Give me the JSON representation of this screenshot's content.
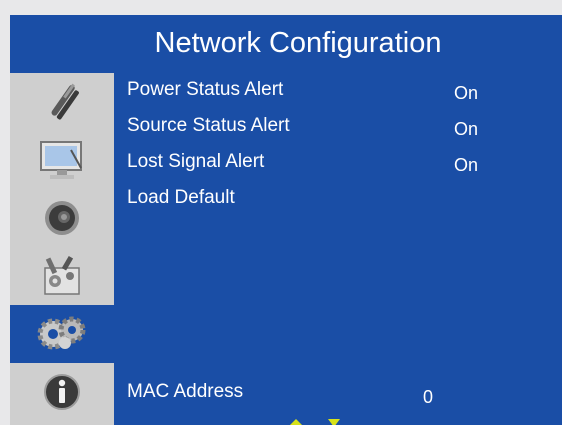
{
  "window": {
    "title": "Network Configuration"
  },
  "sidebar": {
    "items": [
      {
        "icon": "tools-icon"
      },
      {
        "icon": "monitor-icon"
      },
      {
        "icon": "speaker-icon"
      },
      {
        "icon": "settings-tools-icon"
      },
      {
        "icon": "network-gears-icon",
        "selected": true
      },
      {
        "icon": "info-icon"
      }
    ]
  },
  "menu": {
    "items": [
      {
        "label": "Power Status Alert",
        "value": "On"
      },
      {
        "label": "Source Status Alert",
        "value": "On"
      },
      {
        "label": "Lost Signal Alert",
        "value": "On"
      },
      {
        "label": "Load Default",
        "value": ""
      }
    ]
  },
  "mac": {
    "label": "MAC Address",
    "value": "0"
  },
  "colors": {
    "panel_bg": "#1a4ea6",
    "sidebar_bg": "#cfcfcf",
    "frame_bg": "#e8e8ea",
    "arrow": "#d7e21a"
  }
}
